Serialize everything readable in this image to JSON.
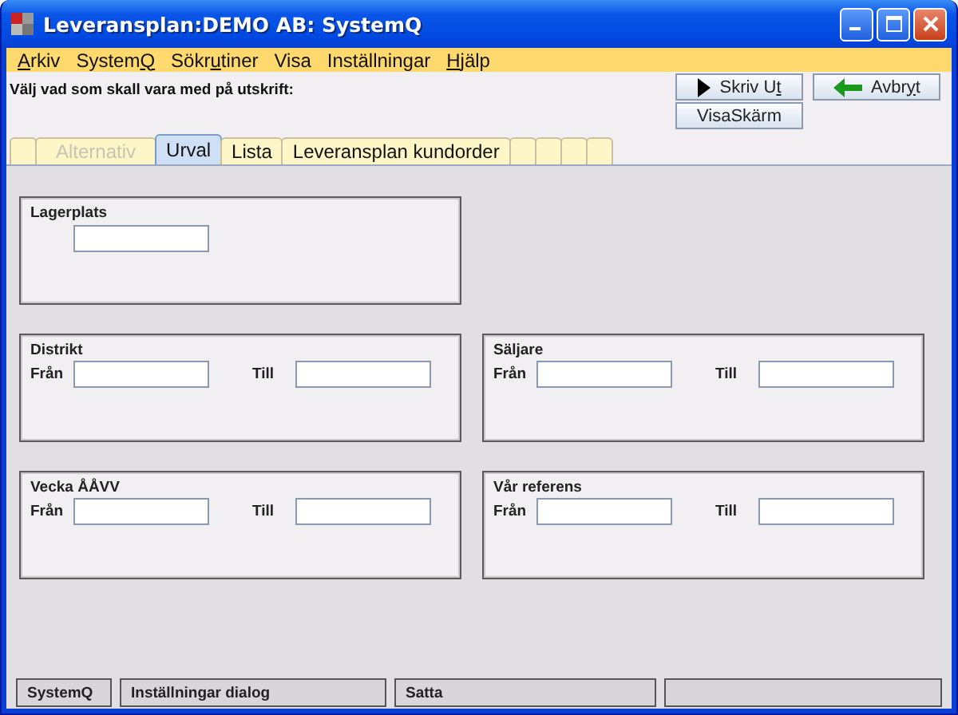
{
  "window": {
    "title": "Leveransplan:DEMO AB: SystemQ"
  },
  "menu": [
    {
      "key": "A",
      "post": "rkiv"
    },
    {
      "pre": "System",
      "key": "Q"
    },
    {
      "pre": "Sökr",
      "key": "u",
      "post": "tiner"
    },
    {
      "pre": "Visa"
    },
    {
      "pre": "Inställningar"
    },
    {
      "key": "H",
      "post": "jälp"
    }
  ],
  "instruction": "Välj vad som skall vara med på utskrift:",
  "buttons": [
    {
      "kind": "print",
      "pre": "Skriv U",
      "key": "t"
    },
    {
      "kind": "cancel",
      "pre": "Avbr",
      "key": "y",
      "post": "t"
    },
    {
      "kind": "plain",
      "pre": "VisaSkärm"
    }
  ],
  "tabs": [
    {
      "selected": false,
      "disabled": false
    },
    {
      "label": "Alternativ",
      "selected": false,
      "disabled": true
    },
    {
      "label": "Urval",
      "selected": true,
      "disabled": false
    },
    {
      "label": "Lista",
      "selected": false,
      "disabled": false
    },
    {
      "label": "Leveransplan kundorder",
      "selected": false,
      "disabled": false
    },
    {
      "selected": false,
      "disabled": false
    },
    {
      "selected": false,
      "disabled": false
    },
    {
      "selected": false,
      "disabled": false
    },
    {
      "selected": false,
      "disabled": false
    }
  ],
  "panels": [
    {
      "kind": "single",
      "title": "Lagerplats"
    },
    {
      "kind": "empty"
    },
    {
      "kind": "range",
      "title": "Distrikt",
      "from_label": "Från",
      "to_label": "Till"
    },
    {
      "kind": "range",
      "title": "Säljare",
      "from_label": "Från",
      "to_label": "Till"
    },
    {
      "kind": "range",
      "title": "Vecka ÅÅVV",
      "from_label": "Från",
      "to_label": "Till"
    },
    {
      "kind": "range",
      "title": "Vår referens",
      "from_label": "Från",
      "to_label": "Till"
    }
  ],
  "status_bar": [
    {
      "kind": "text",
      "text": "SystemQ"
    },
    {
      "kind": "text",
      "text": "Inställningar dialog"
    },
    {
      "kind": "text",
      "text": "Satta"
    },
    {
      "kind": "blank"
    }
  ]
}
